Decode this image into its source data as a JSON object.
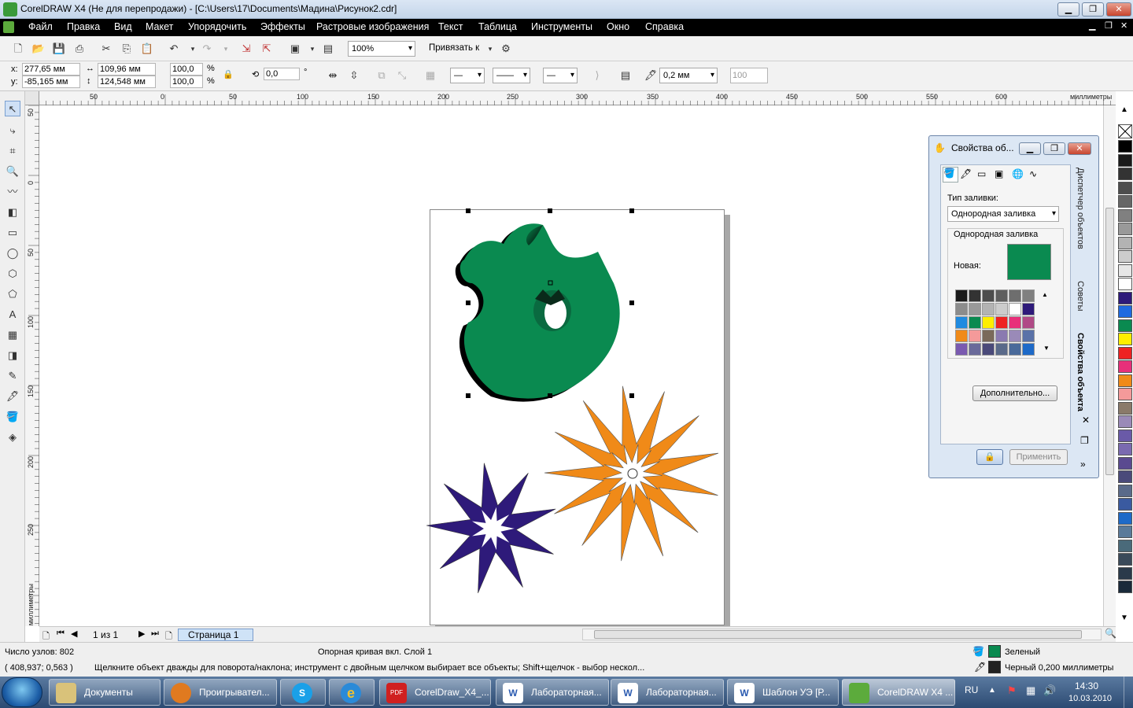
{
  "window": {
    "title": "CorelDRAW X4 (Не для перепродажи) - [C:\\Users\\17\\Documents\\Мадина\\Рисунок2.cdr]",
    "min": "▁",
    "max": "❐",
    "close": "✕"
  },
  "menu": [
    "Файл",
    "Правка",
    "Вид",
    "Макет",
    "Упорядочить",
    "Эффекты",
    "Растровые изображения",
    "Текст",
    "Таблица",
    "Инструменты",
    "Окно",
    "Справка"
  ],
  "toolbar": {
    "zoom": "100%",
    "snap": "Привязать к"
  },
  "property_bar": {
    "x_label": "x:",
    "x_value": "277,65 мм",
    "y_label": "y:",
    "y_value": "-85,165 мм",
    "w_value": "109,96 мм",
    "h_value": "124,548 мм",
    "scale_x": "100,0",
    "scale_y": "100,0",
    "pct": "%",
    "angle": "0,0",
    "deg": "°",
    "outline_width": "0,2 мм",
    "percent_field": "100"
  },
  "ruler": {
    "h_ticks": [
      "50",
      "0",
      "50",
      "100",
      "150",
      "200",
      "250",
      "300",
      "350",
      "400",
      "450",
      "500",
      "550",
      "600"
    ],
    "unit": "миллиметры",
    "v_ticks": [
      "50",
      "0",
      "50",
      "100",
      "150",
      "200",
      "250"
    ]
  },
  "page_nav": {
    "counter": "1 из 1",
    "tab": "Страница 1"
  },
  "panel": {
    "title": "Свойства об...",
    "fill_type_label": "Тип заливки:",
    "fill_type_value": "Однородная заливка",
    "group_label": "Однородная заливка",
    "new_label": "Новая:",
    "new_color": "#0a8a50",
    "more_button": "Дополнительно...",
    "apply_button": "Применить",
    "side_tabs": [
      "Диспетчер объектов",
      "Советы",
      "Свойства объекта"
    ]
  },
  "panel_grid_colors": [
    "#1a1a1a",
    "#333333",
    "#4d4d4d",
    "#5e5e5e",
    "#6e6e6e",
    "#808080",
    "#8c8c8c",
    "#999999",
    "#b3b3b3",
    "#cccccc",
    "#ffffff",
    "#2e1a7a",
    "#1f8ae0",
    "#0a8a50",
    "#ffee00",
    "#ee2222",
    "#e8307a",
    "#b04a86",
    "#f08a18",
    "#f49a9a",
    "#7a6a5a",
    "#8a7ab0",
    "#9a8ab8",
    "#5a72a8",
    "#7a5ab0",
    "#6a6a9a",
    "#4a4a7a",
    "#5a6a8a",
    "#4a6a9a",
    "#1e6ac8"
  ],
  "palette_colors": [
    "#000000",
    "#1a1a1a",
    "#333333",
    "#4d4d4d",
    "#666666",
    "#808080",
    "#999999",
    "#b3b3b3",
    "#cccccc",
    "#e6e6e6",
    "#ffffff",
    "#2e1a7a",
    "#1f6ae0",
    "#0a8a50",
    "#ffee00",
    "#ee2222",
    "#e8307a",
    "#f08a18",
    "#f49a9a",
    "#8a7a6a",
    "#9a8ab8",
    "#6a5aa8",
    "#7a6ab0",
    "#5a4a90",
    "#4a4a7a",
    "#5a6a8a",
    "#3a5aa0",
    "#1e6ac8",
    "#5a7a9a",
    "#4a6a7a",
    "#3a4a5a",
    "#2a3a4a",
    "#1a2a3a"
  ],
  "status": {
    "nodes": "Число узлов: 802",
    "object": "Опорная кривая вкл. Слой 1",
    "coords": "( 408,937; 0,563 )",
    "hint": "Щелкните объект дважды для поворота/наклона; инструмент с двойным щелчком выбирает все объекты; Shift+щелчок - выбор нескол...",
    "fill_name": "Зеленый",
    "fill_color": "#0a8a50",
    "outline": "Черный  0,200 миллиметры"
  },
  "taskbar": {
    "items": [
      "Документы",
      "Проигрывател...",
      "",
      "",
      "CorelDraw_X4_...",
      "Лабораторная...",
      "Лабораторная...",
      "Шаблон УЭ [Р...",
      "CorelDRAW X4 ..."
    ],
    "lang": "RU",
    "time": "14:30",
    "date": "10.03.2010"
  }
}
